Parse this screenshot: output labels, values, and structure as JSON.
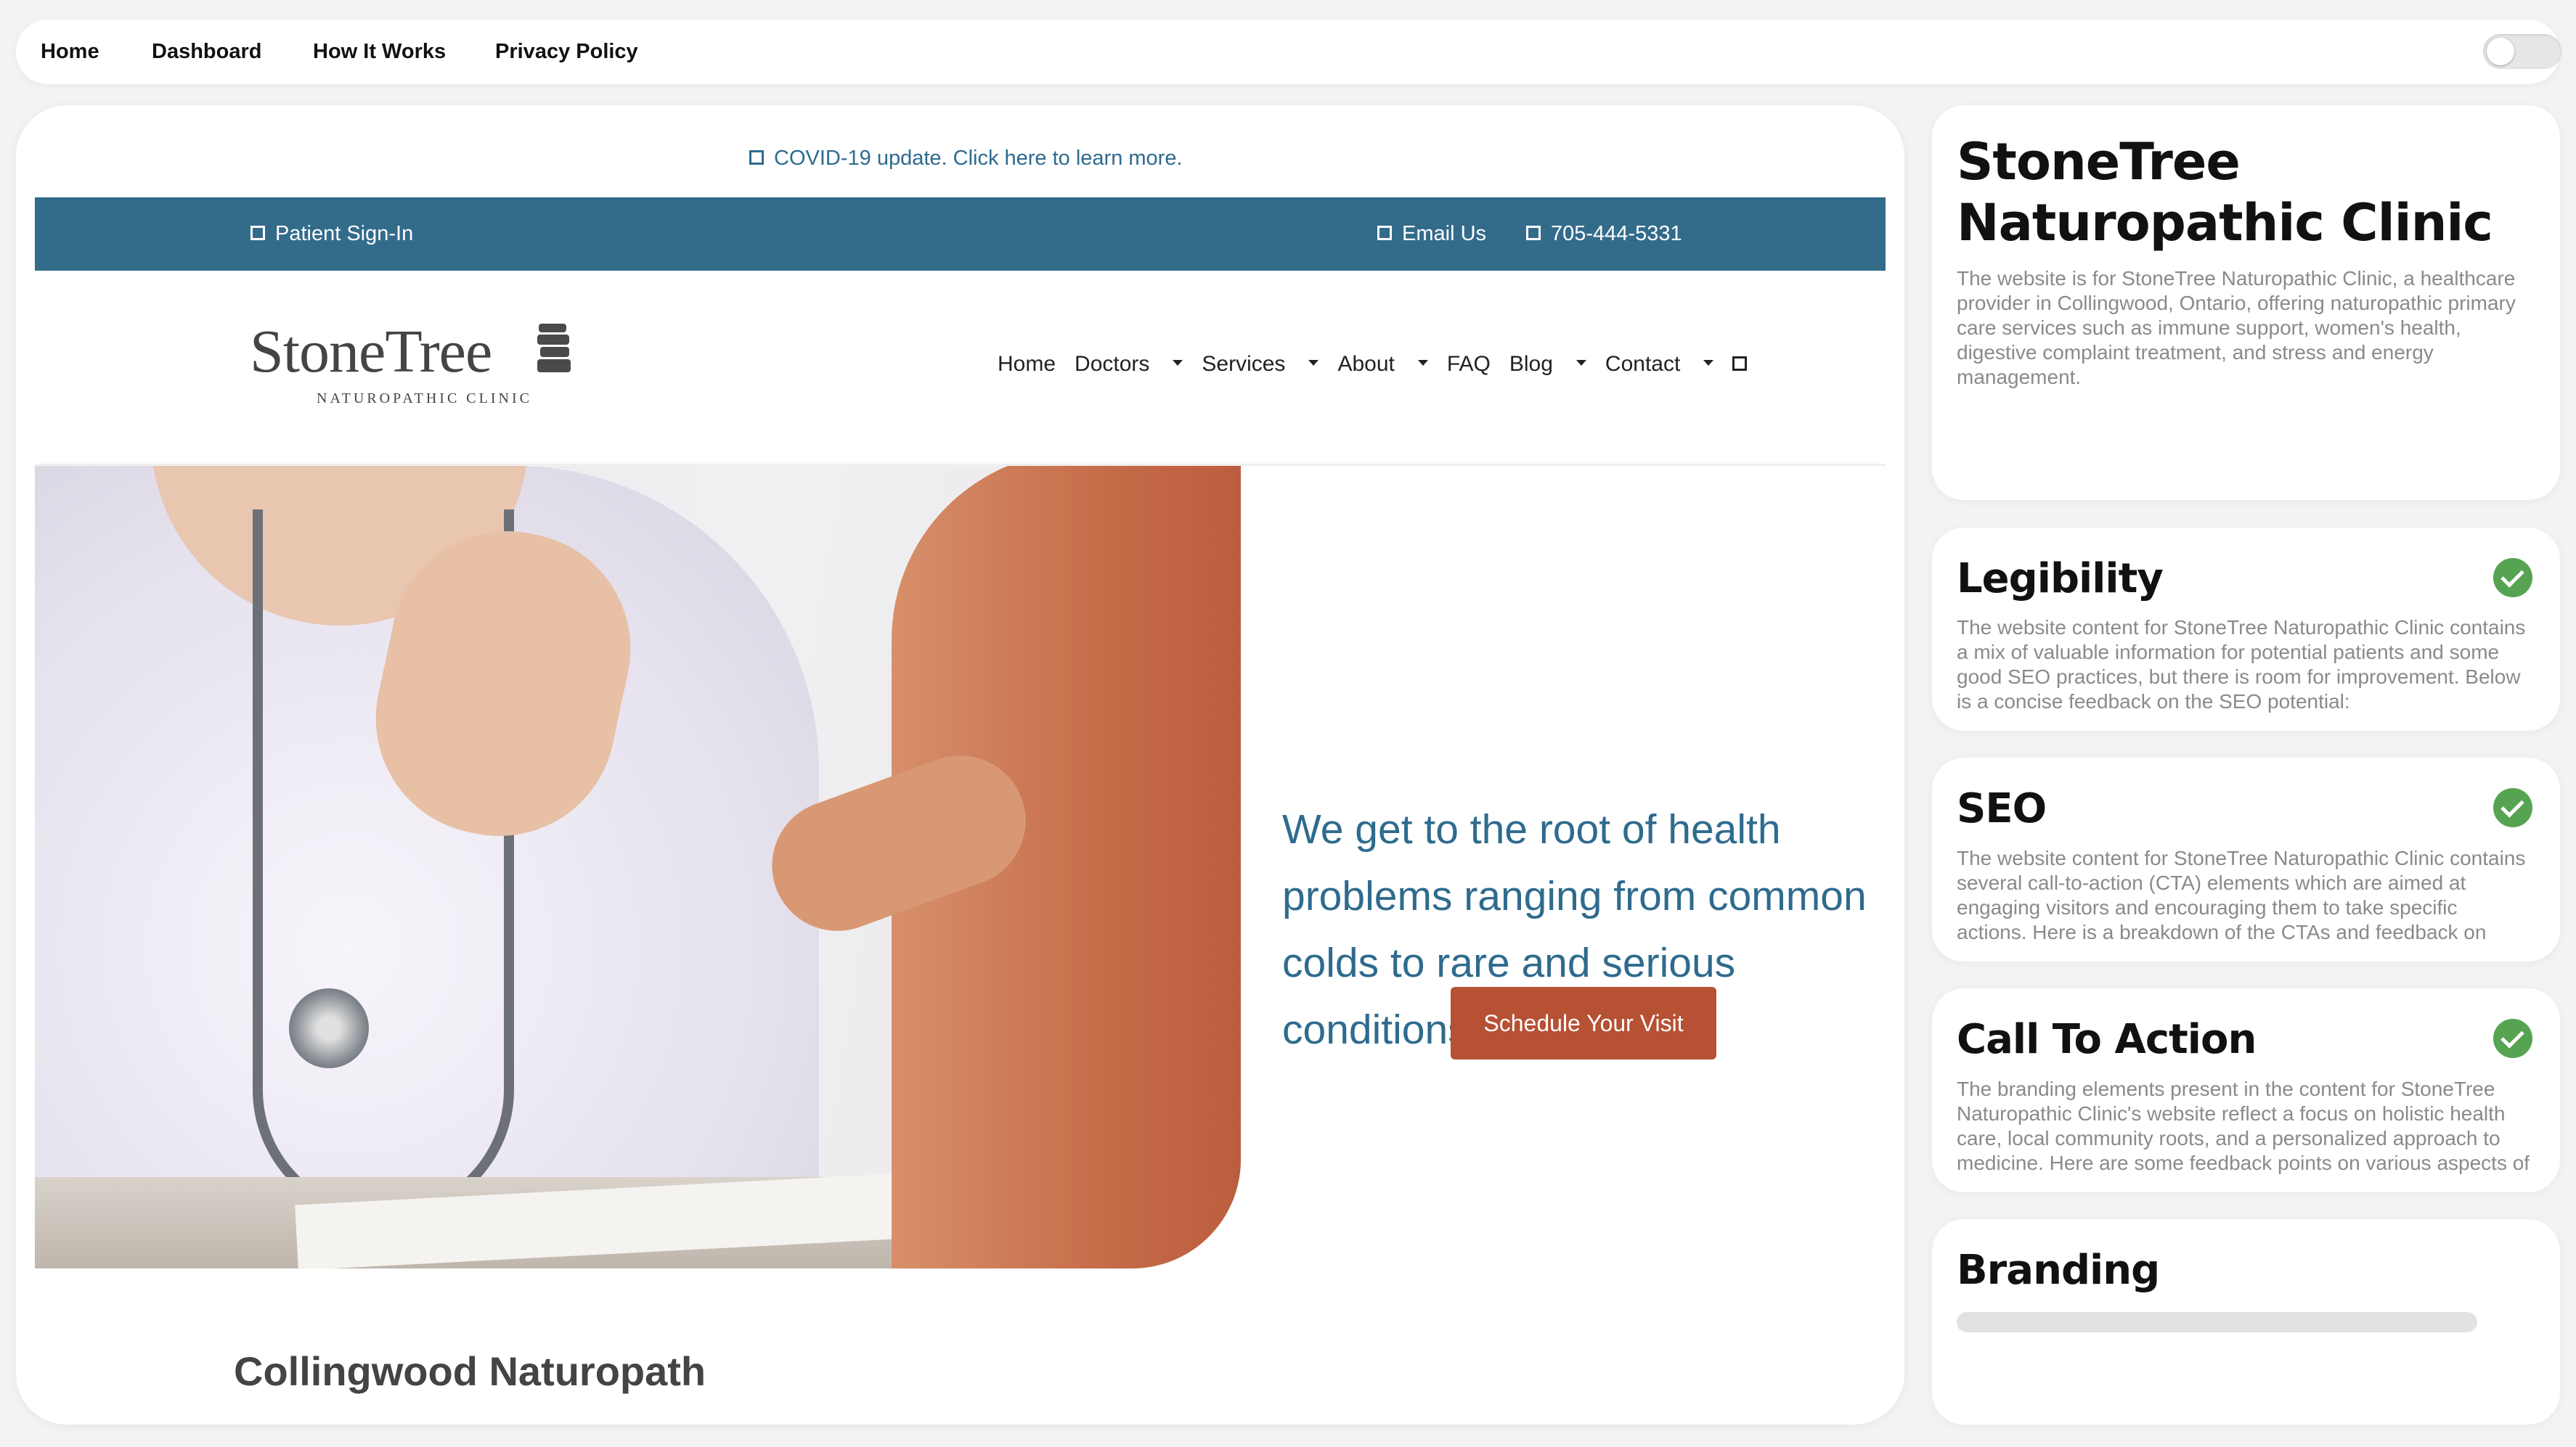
{
  "topnav": {
    "links": [
      "Home",
      "Dashboard",
      "How It Works",
      "Privacy Policy"
    ]
  },
  "site": {
    "announcement": "COVID-19 update. Click here to learn more.",
    "utility_bar": {
      "sign_in": "Patient Sign-In",
      "email": "Email Us",
      "phone": "705-444-5331"
    },
    "logo": {
      "name": "StoneTree",
      "tagline": "Naturopathic Clinic"
    },
    "nav": {
      "home": "Home",
      "doctors": "Doctors",
      "services": "Services",
      "about": "About",
      "faq": "FAQ",
      "blog": "Blog",
      "contact": "Contact"
    },
    "hero": {
      "headline": "We get to the root of health problems ranging from common colds to rare and serious conditions.",
      "cta": "Schedule Your Visit"
    },
    "section_heading": "Collingwood Naturopath"
  },
  "sidebar": {
    "summary": {
      "title": "StoneTree Naturopathic Clinic",
      "text": "The website is for StoneTree Naturopathic Clinic, a healthcare provider in Collingwood, Ontario, offering naturopathic primary care services such as immune support, women's health, digestive complaint treatment, and stress and energy management."
    },
    "legibility": {
      "title": "Legibility",
      "text": "The website content for StoneTree Naturopathic Clinic contains a mix of valuable information for potential patients and some good SEO practices, but there is room for improvement. Below is a concise feedback on the SEO potential:"
    },
    "seo": {
      "title": "SEO",
      "text": "The website content for StoneTree Naturopathic Clinic contains several call-to-action (CTA) elements which are aimed at engaging visitors and encouraging them to take specific actions. Here is a breakdown of the CTAs and feedback on their effectiveness:"
    },
    "cta": {
      "title": "Call To Action",
      "text": "The branding elements present in the content for StoneTree Naturopathic Clinic's website reflect a focus on holistic health care, local community roots, and a personalized approach to medicine. Here are some feedback points on various aspects of the content:"
    },
    "branding": {
      "title": "Branding"
    }
  },
  "colors": {
    "brand_blue": "#336b8b",
    "cta_orange": "#b65134",
    "check_green": "#56a352"
  }
}
